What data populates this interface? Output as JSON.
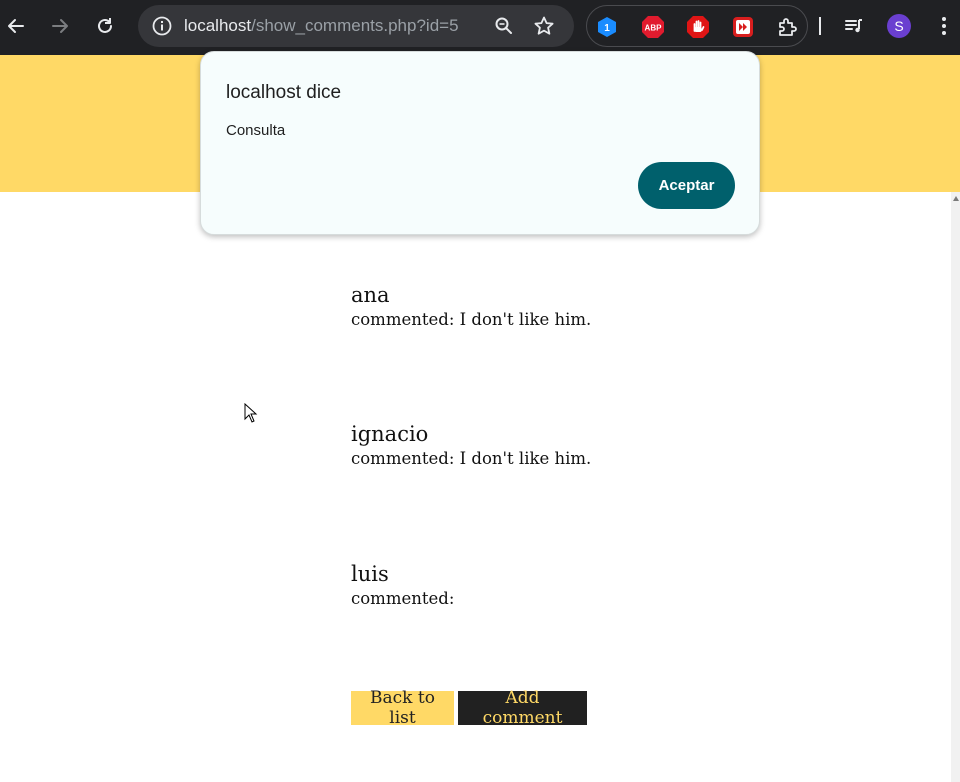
{
  "browser": {
    "url_host": "localhost",
    "url_path": "/show_comments.php?id=5",
    "extensions": [
      {
        "name": "1password-extension-icon",
        "badge": "1",
        "color": "#1a8cff"
      },
      {
        "name": "adblock-plus-extension-icon",
        "badge": "ABP",
        "color": "#e11b2e"
      },
      {
        "name": "stop-hand-extension-icon",
        "color": "#e01515"
      },
      {
        "name": "video-forward-extension-icon",
        "color": "#d81e1e"
      }
    ],
    "profile_initial": "S",
    "profile_color": "#6a3fd0"
  },
  "theme": {
    "header_color": "#ffd966",
    "dark_button_color": "#212121",
    "dialog_button_color": "#00606c"
  },
  "dialog": {
    "title": "localhost dice",
    "message": "Consulta",
    "ok_label": "Aceptar"
  },
  "comments": [
    {
      "author": "ana",
      "text": "commented: I don't like him."
    },
    {
      "author": "ignacio",
      "text": "commented: I don't like him."
    },
    {
      "author": "luis",
      "text": "commented:"
    }
  ],
  "actions": {
    "back_label": "Back to list",
    "add_label": "Add comment"
  }
}
